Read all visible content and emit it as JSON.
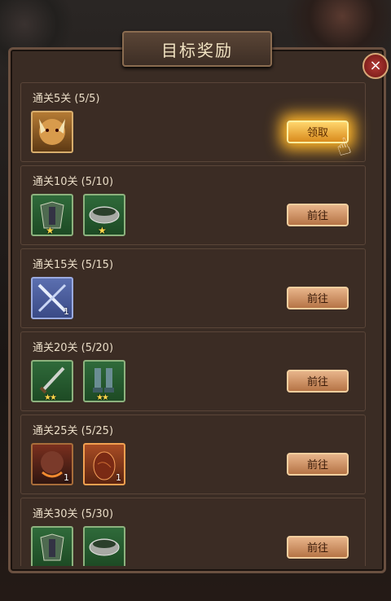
{
  "title": "目标奖励",
  "close_label": "×",
  "rewards": [
    {
      "label": "通关5关 (5/5)",
      "button": "领取",
      "state": "claim",
      "items": [
        {
          "icon": "beast-hero-icon",
          "style": "gold",
          "count": ""
        }
      ]
    },
    {
      "label": "通关10关 (5/10)",
      "button": "前往",
      "state": "go",
      "items": [
        {
          "icon": "armor-icon",
          "style": "green",
          "count": "",
          "stars": "★"
        },
        {
          "icon": "belt-icon",
          "style": "green",
          "count": "",
          "stars": "★"
        }
      ]
    },
    {
      "label": "通关15关 (5/15)",
      "button": "前往",
      "state": "go",
      "items": [
        {
          "icon": "crossed-blades-icon",
          "style": "blue",
          "count": "1"
        }
      ]
    },
    {
      "label": "通关20关 (5/20)",
      "button": "前往",
      "state": "go",
      "items": [
        {
          "icon": "sword-icon",
          "style": "green",
          "count": "",
          "stars": "★★"
        },
        {
          "icon": "boots-icon",
          "style": "green",
          "count": "",
          "stars": "★★"
        }
      ]
    },
    {
      "label": "通关25关 (5/25)",
      "button": "前往",
      "state": "go",
      "items": [
        {
          "icon": "dragon-hero-icon",
          "style": "dark",
          "count": "1"
        },
        {
          "icon": "egg-icon",
          "style": "orange",
          "count": "1"
        }
      ]
    },
    {
      "label": "通关30关 (5/30)",
      "button": "前往",
      "state": "go",
      "items": [
        {
          "icon": "armor-icon",
          "style": "green",
          "count": ""
        },
        {
          "icon": "belt-icon",
          "style": "green",
          "count": ""
        }
      ]
    }
  ]
}
